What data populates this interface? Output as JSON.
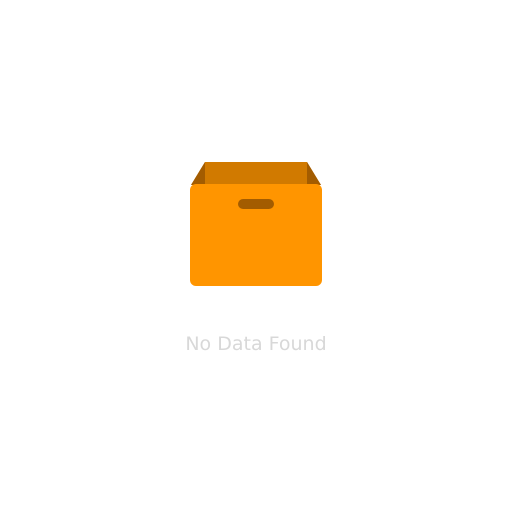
{
  "empty_state": {
    "message": "No Data Found",
    "icon": "empty-box-icon",
    "colors": {
      "box_front": "#ff9500",
      "box_inner": "#d17a00",
      "box_flap": "#a35c00",
      "handle": "#a35c00",
      "message_text": "#d8d8d8",
      "background": "#ffffff"
    }
  }
}
